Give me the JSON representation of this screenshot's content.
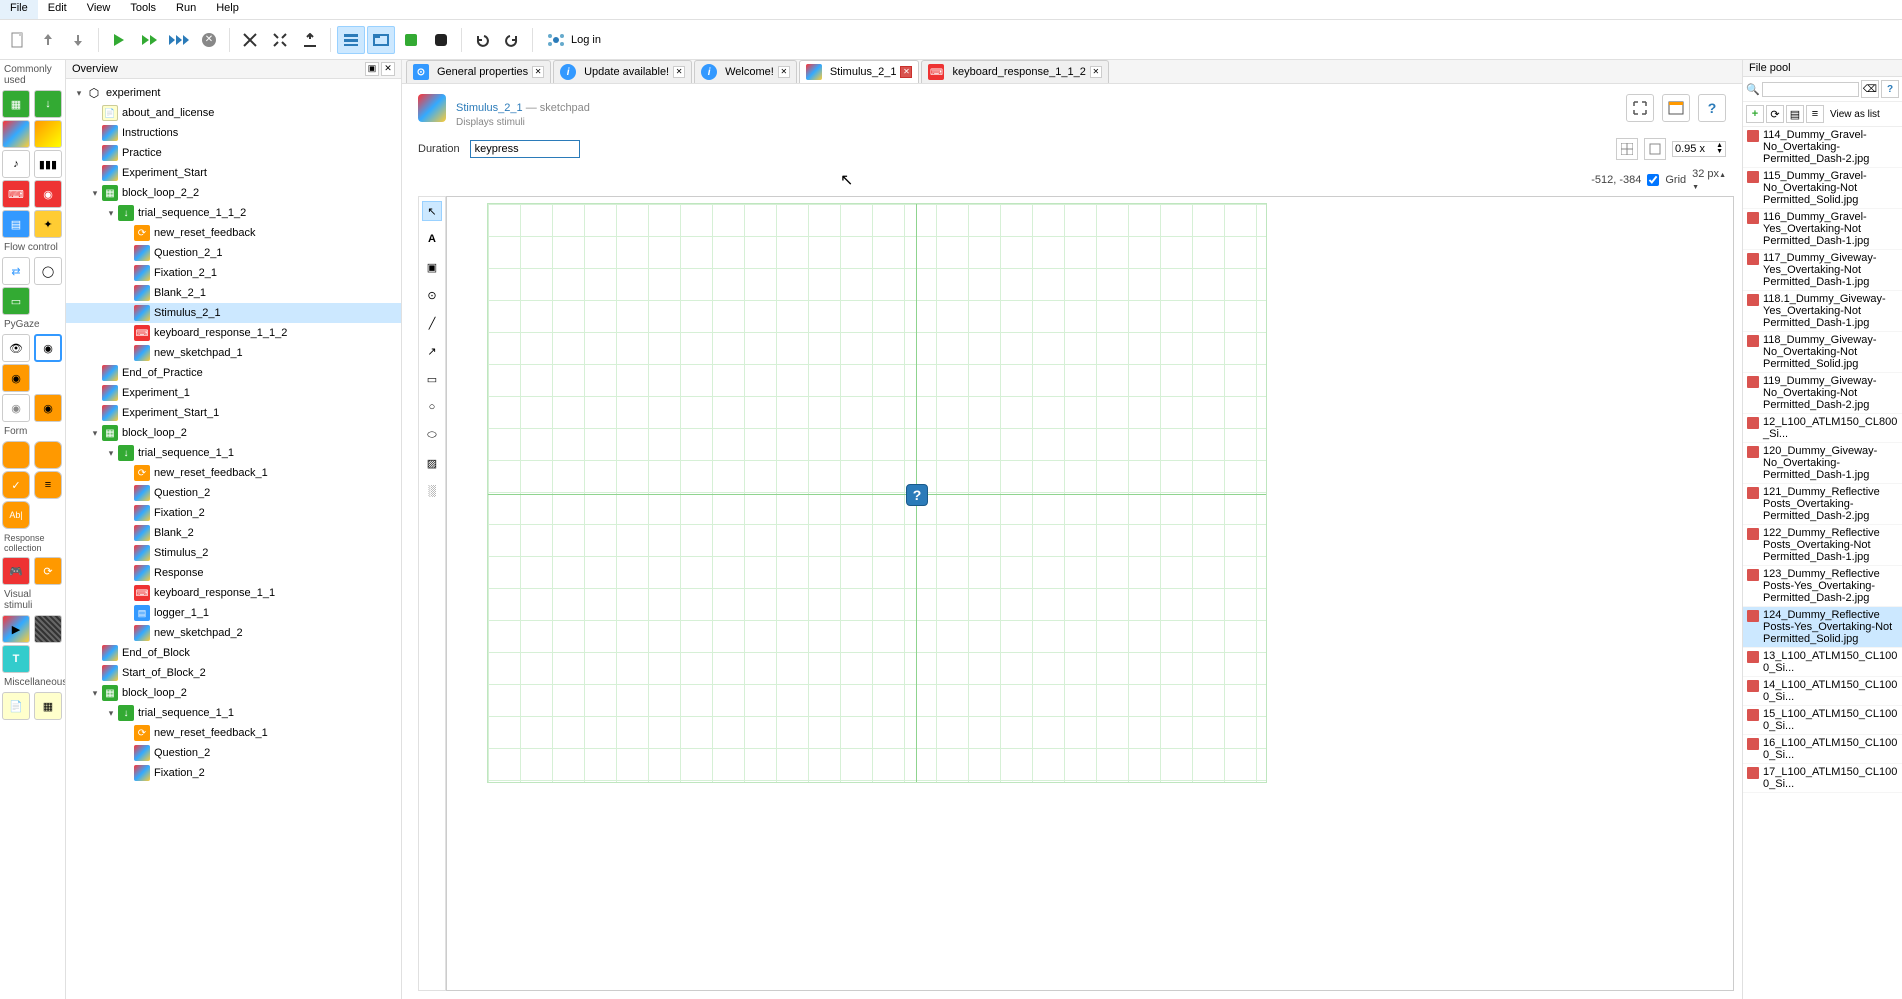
{
  "menu": [
    "File",
    "Edit",
    "View",
    "Tools",
    "Run",
    "Help"
  ],
  "login_label": "Log in",
  "overview": {
    "title": "Overview",
    "tree": [
      {
        "d": 0,
        "exp": true,
        "icon": "experiment",
        "label": "experiment"
      },
      {
        "d": 1,
        "icon": "note",
        "label": "about_and_license"
      },
      {
        "d": 1,
        "icon": "sketch",
        "label": "Instructions"
      },
      {
        "d": 1,
        "icon": "sketch",
        "label": "Practice"
      },
      {
        "d": 1,
        "icon": "sketch",
        "label": "Experiment_Start"
      },
      {
        "d": 1,
        "exp": true,
        "icon": "loop",
        "label": "block_loop_2_2"
      },
      {
        "d": 2,
        "exp": true,
        "icon": "sequence",
        "label": "trial_sequence_1_1_2"
      },
      {
        "d": 3,
        "icon": "script",
        "label": "new_reset_feedback"
      },
      {
        "d": 3,
        "icon": "sketch",
        "label": "Question_2_1"
      },
      {
        "d": 3,
        "icon": "sketch",
        "label": "Fixation_2_1"
      },
      {
        "d": 3,
        "icon": "sketch",
        "label": "Blank_2_1"
      },
      {
        "d": 3,
        "icon": "sketch",
        "label": "Stimulus_2_1",
        "selected": true
      },
      {
        "d": 3,
        "icon": "keyboard",
        "label": "keyboard_response_1_1_2"
      },
      {
        "d": 3,
        "icon": "sketch",
        "label": "new_sketchpad_1"
      },
      {
        "d": 1,
        "icon": "sketch",
        "label": "End_of_Practice"
      },
      {
        "d": 1,
        "icon": "sketch",
        "label": "Experiment_1"
      },
      {
        "d": 1,
        "icon": "sketch",
        "label": "Experiment_Start_1"
      },
      {
        "d": 1,
        "exp": true,
        "icon": "loop",
        "label": "block_loop_2"
      },
      {
        "d": 2,
        "exp": true,
        "icon": "sequence",
        "label": "trial_sequence_1_1"
      },
      {
        "d": 3,
        "icon": "script",
        "label": "new_reset_feedback_1"
      },
      {
        "d": 3,
        "icon": "sketch",
        "label": "Question_2"
      },
      {
        "d": 3,
        "icon": "sketch",
        "label": "Fixation_2"
      },
      {
        "d": 3,
        "icon": "sketch",
        "label": "Blank_2"
      },
      {
        "d": 3,
        "icon": "sketch",
        "label": "Stimulus_2"
      },
      {
        "d": 3,
        "icon": "sketch",
        "label": "Response"
      },
      {
        "d": 3,
        "icon": "keyboard",
        "label": "keyboard_response_1_1"
      },
      {
        "d": 3,
        "icon": "logger",
        "label": "logger_1_1"
      },
      {
        "d": 3,
        "icon": "sketch",
        "label": "new_sketchpad_2"
      },
      {
        "d": 1,
        "icon": "sketch",
        "label": "End_of_Block"
      },
      {
        "d": 1,
        "icon": "sketch",
        "label": "Start_of_Block_2"
      },
      {
        "d": 1,
        "exp": true,
        "icon": "loop",
        "label": "block_loop_2"
      },
      {
        "d": 2,
        "exp": true,
        "icon": "sequence",
        "label": "trial_sequence_1_1"
      },
      {
        "d": 3,
        "icon": "script",
        "label": "new_reset_feedback_1"
      },
      {
        "d": 3,
        "icon": "sketch",
        "label": "Question_2"
      },
      {
        "d": 3,
        "icon": "sketch",
        "label": "Fixation_2"
      }
    ]
  },
  "tabs": [
    {
      "icon": "props",
      "label": "General properties",
      "active": false
    },
    {
      "icon": "info",
      "label": "Update available!",
      "active": false
    },
    {
      "icon": "info",
      "label": "Welcome!",
      "active": false
    },
    {
      "icon": "sketch",
      "label": "Stimulus_2_1",
      "active": true,
      "closeRed": true
    },
    {
      "icon": "keyboard",
      "label": "keyboard_response_1_1_2",
      "active": false
    }
  ],
  "editor": {
    "title": "Stimulus_2_1",
    "type_suffix": " — sketchpad",
    "subtitle": "Displays stimuli",
    "duration_label": "Duration",
    "duration_value": "keypress",
    "zoom": "0.95 x",
    "coords": "-512, -384",
    "grid_label": "Grid",
    "grid_checked": true,
    "grid_px": "32 px"
  },
  "toolbox": {
    "sections": [
      {
        "label": "Commonly used"
      },
      {
        "label": "Flow control"
      },
      {
        "label": "PyGaze"
      },
      {
        "label": "Form"
      },
      {
        "label": "Response collection"
      },
      {
        "label": "Visual stimuli"
      },
      {
        "label": "Miscellaneous"
      }
    ]
  },
  "filepool": {
    "title": "File pool",
    "view_label": "View as list",
    "items": [
      {
        "t": "114_Dummy_Gravel-No_Overtaking-Permitted_Dash-2.jpg"
      },
      {
        "t": "115_Dummy_Gravel-No_Overtaking-Not Permitted_Solid.jpg"
      },
      {
        "t": "116_Dummy_Gravel-Yes_Overtaking-Not Permitted_Dash-1.jpg"
      },
      {
        "t": "117_Dummy_Giveway-Yes_Overtaking-Not Permitted_Dash-1.jpg"
      },
      {
        "t": "118.1_Dummy_Giveway-Yes_Overtaking-Not Permitted_Dash-1.jpg"
      },
      {
        "t": "118_Dummy_Giveway-No_Overtaking-Not Permitted_Solid.jpg"
      },
      {
        "t": "119_Dummy_Giveway-No_Overtaking-Not Permitted_Dash-2.jpg"
      },
      {
        "t": "12_L100_ATLM150_CL800_Si..."
      },
      {
        "t": "120_Dummy_Giveway-No_Overtaking-Permitted_Dash-1.jpg"
      },
      {
        "t": "121_Dummy_Reflective Posts_Overtaking-Permitted_Dash-2.jpg"
      },
      {
        "t": "122_Dummy_Reflective Posts_Overtaking-Not Permitted_Dash-1.jpg"
      },
      {
        "t": "123_Dummy_Reflective Posts-Yes_Overtaking-Permitted_Dash-2.jpg"
      },
      {
        "t": "124_Dummy_Reflective Posts-Yes_Overtaking-Not Permitted_Solid.jpg",
        "selected": true
      },
      {
        "t": "13_L100_ATLM150_CL1000_Si..."
      },
      {
        "t": "14_L100_ATLM150_CL1000_Si..."
      },
      {
        "t": "15_L100_ATLM150_CL1000_Si..."
      },
      {
        "t": "16_L100_ATLM150_CL1000_Si..."
      },
      {
        "t": "17_L100_ATLM150_CL1000_Si..."
      }
    ]
  }
}
